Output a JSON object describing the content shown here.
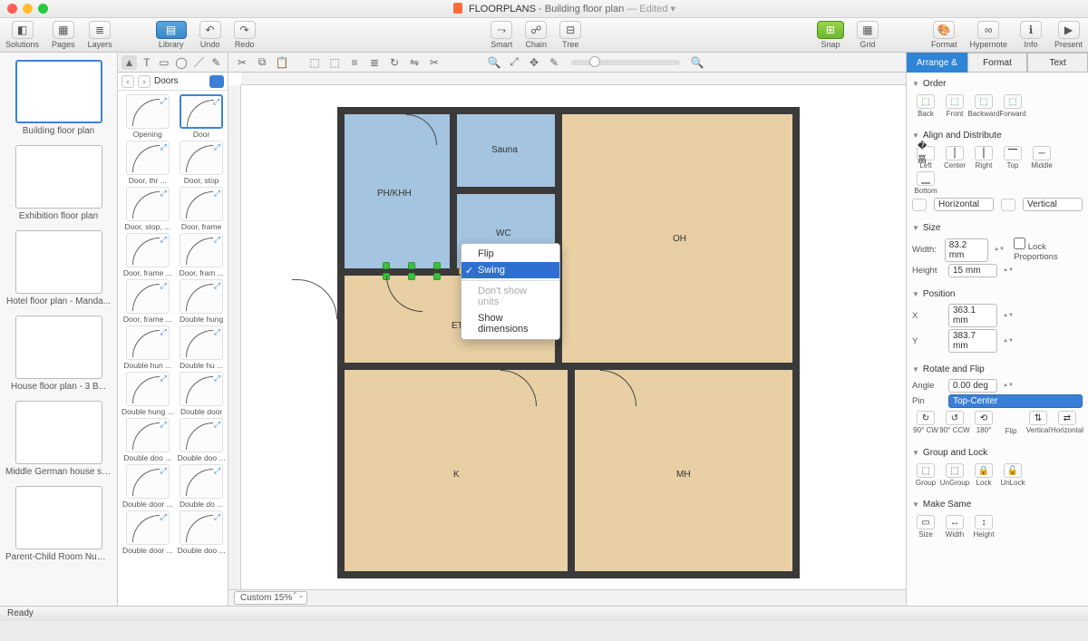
{
  "title": {
    "app": "FLOORPLANS",
    "doc": "Building floor plan",
    "suffix": "— Edited ▾"
  },
  "toolbar": {
    "solutions": "Solutions",
    "pages": "Pages",
    "layers": "Layers",
    "library": "Library",
    "undo": "Undo",
    "redo": "Redo",
    "smart": "Smart",
    "chain": "Chain",
    "tree": "Tree",
    "snap": "Snap",
    "grid": "Grid",
    "format": "Format",
    "hypernote": "Hypernote",
    "info": "Info",
    "present": "Present"
  },
  "thumbs": [
    "Building floor plan",
    "Exhibition floor plan",
    "Hotel floor plan - Manda...",
    "House floor plan - 3 B...",
    "Middle German house sc...",
    "Parent-Child Room Num..."
  ],
  "library": {
    "crumb": "Doors",
    "items": [
      "Opening",
      "Door",
      "Door, thr ...",
      "Door, stop",
      "Door, stop, ...",
      "Door, frame",
      "Door, frame ...",
      "Door, fram ...",
      "Door, frame ...",
      "Double hung",
      "Double hun ...",
      "Double hu ...",
      "Double hung ...",
      "Double door",
      "Double doo ...",
      "Double doo ...",
      "Double door ...",
      "Double do ...",
      "Double door ...",
      "Double doo ..."
    ],
    "selectedIndex": 1
  },
  "canvas": {
    "zoom": "Custom 15%",
    "rooms": {
      "sauna": "Sauna",
      "ph": "PH/KHH",
      "wc": "WC",
      "oh": "OH",
      "et": "ET",
      "k": "K",
      "mh": "MH"
    },
    "contextMenu": [
      "Flip",
      "Swing",
      "Don't show units",
      "Show dimensions"
    ]
  },
  "inspector": {
    "tabs": [
      "Arrange & Size",
      "Format",
      "Text"
    ],
    "order": {
      "hdr": "Order",
      "back": "Back",
      "front": "Front",
      "backward": "Backward",
      "forward": "Forward"
    },
    "align": {
      "hdr": "Align and Distribute",
      "left": "Left",
      "center": "Center",
      "right": "Right",
      "top": "Top",
      "middle": "Middle",
      "bottom": "Bottom",
      "hsel": "Horizontal",
      "vsel": "Vertical"
    },
    "size": {
      "hdr": "Size",
      "wlbl": "Width:",
      "w": "83.2 mm",
      "hlbl": "Height",
      "h": "15 mm",
      "lock": "Lock Proportions"
    },
    "pos": {
      "hdr": "Position",
      "xlbl": "X",
      "x": "363.1 mm",
      "ylbl": "Y",
      "y": "383.7 mm"
    },
    "rot": {
      "hdr": "Rotate and Flip",
      "alabel": "Angle",
      "angle": "0.00 deg",
      "plabel": "Pin",
      "pin": "Top-Center",
      "cw": "90° CW",
      "ccw": "90° CCW",
      "d180": "180°",
      "flip": "Flip",
      "vert": "Vertical",
      "horiz": "Horizontal"
    },
    "grp": {
      "hdr": "Group and Lock",
      "group": "Group",
      "ungroup": "UnGroup",
      "lock": "Lock",
      "unlock": "UnLock"
    },
    "same": {
      "hdr": "Make Same",
      "size": "Size",
      "width": "Width",
      "height": "Height"
    }
  },
  "status": "Ready"
}
